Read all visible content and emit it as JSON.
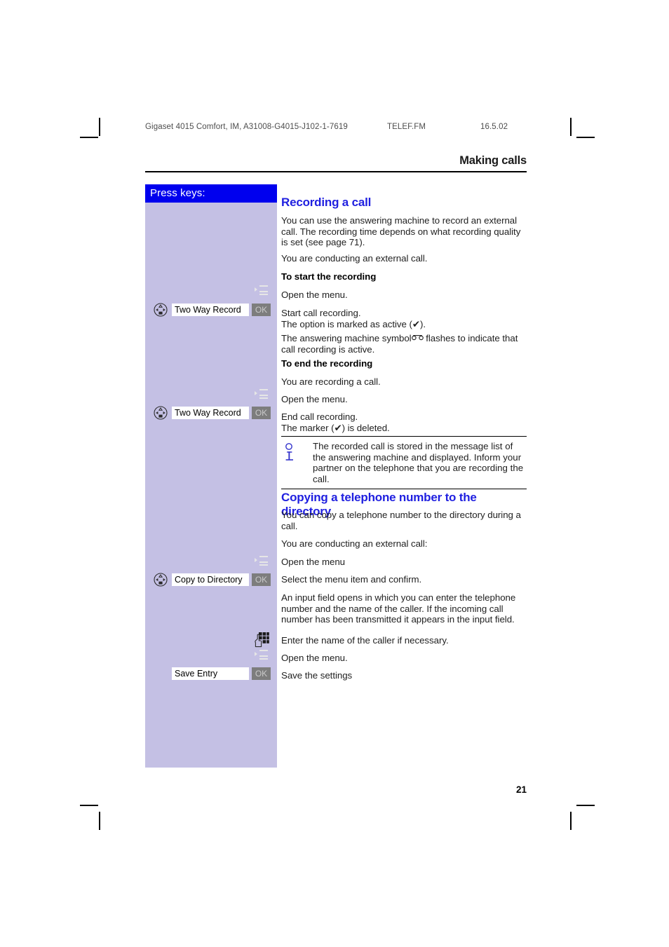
{
  "header": {
    "doc_id": "Gigaset 4015 Comfort, IM, A31008-G4015-J102-1-7619",
    "fm_file": "TELEF.FM",
    "date": "16.5.02",
    "chapter": "Making calls"
  },
  "sidebar": {
    "title": "Press keys:",
    "rows": [
      {
        "label": "Two Way Record",
        "ok": "OK"
      },
      {
        "label": "Two Way Record",
        "ok": "OK"
      },
      {
        "label": "Copy to Directory",
        "ok": "OK"
      },
      {
        "label": "Save Entry",
        "ok": "OK"
      }
    ],
    "icons": {
      "menu": "menu-softkey-icon",
      "nav": "navigation-key-icon",
      "keypad": "keypad-entry-icon"
    }
  },
  "main": {
    "section1_title": "Recording a call",
    "p1": "You can use the answering machine to record an external call. The recording time depends on what recording quality is set (see page 71).",
    "p2": "You are conducting an external call.",
    "sub1": "To start the recording",
    "p3": "Open the menu.",
    "p4_line1": "Start call recording.",
    "p4_line2": "The option is marked as active (✔).",
    "p5_pre": "The answering machine symbol",
    "p5_post": "flashes to indicate that call recording is active.",
    "sub2": "To end the recording",
    "p6": "You are recording a call.",
    "p7": "Open the menu.",
    "p8_line1": "End call recording.",
    "p8_line2": "The marker (✔) is deleted.",
    "note": "The recorded call is stored in the message list of the answering machine and displayed. Inform your partner on the telephone that you are recording the call.",
    "section2_title": "Copying a telephone number to the directory",
    "p9": "You can copy a telephone number to the directory during a call.",
    "p10": "You are conducting an external call:",
    "p11": "Open the menu",
    "p12": "Select the menu item and confirm.",
    "p13": "An input field opens in which you can enter the telephone number and the name of the caller. If the incoming call number has been transmitted it appears in the input field.",
    "p14": "Enter the name of the caller if necessary.",
    "p15": "Open the menu.",
    "p16": "Save the settings"
  },
  "footer": {
    "page_number": "21"
  },
  "colors": {
    "heading_blue": "#2020e0",
    "sidebar_header_blue": "#0000ee",
    "sidebar_body": "#c4c0e4",
    "key_gray": "#7d7d7d"
  }
}
